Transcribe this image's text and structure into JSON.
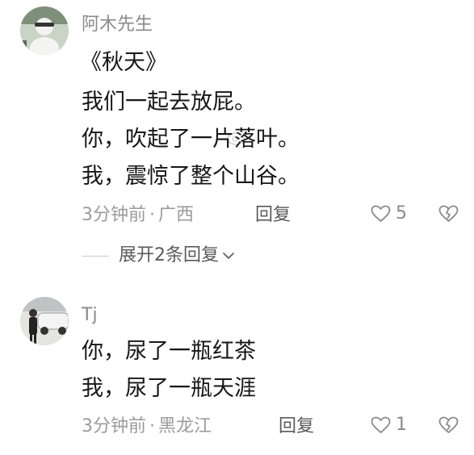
{
  "comments": [
    {
      "username": "阿木先生",
      "lines": [
        "《秋天》",
        "我们一起去放屁。",
        "你，吹起了一片落叶。",
        "我，震惊了整个山谷。"
      ],
      "time": "3分钟前",
      "separator": "·",
      "location": "广西",
      "reply_label": "回复",
      "like_count": "5"
    },
    {
      "username": "Tj",
      "lines": [
        "你，尿了一瓶红茶",
        "我，尿了一瓶天涯"
      ],
      "time": "3分钟前",
      "separator": "·",
      "location": "黑龙江",
      "reply_label": "回复",
      "like_count": "1"
    }
  ],
  "expand_replies_label": "展开2条回复",
  "icons": {
    "like": "heart-outline-icon",
    "dislike": "broken-heart-icon",
    "expand": "chevron-down-icon"
  },
  "colors": {
    "meta": "#9b9b9b",
    "username": "#8a8a8a",
    "body": "#161616"
  }
}
